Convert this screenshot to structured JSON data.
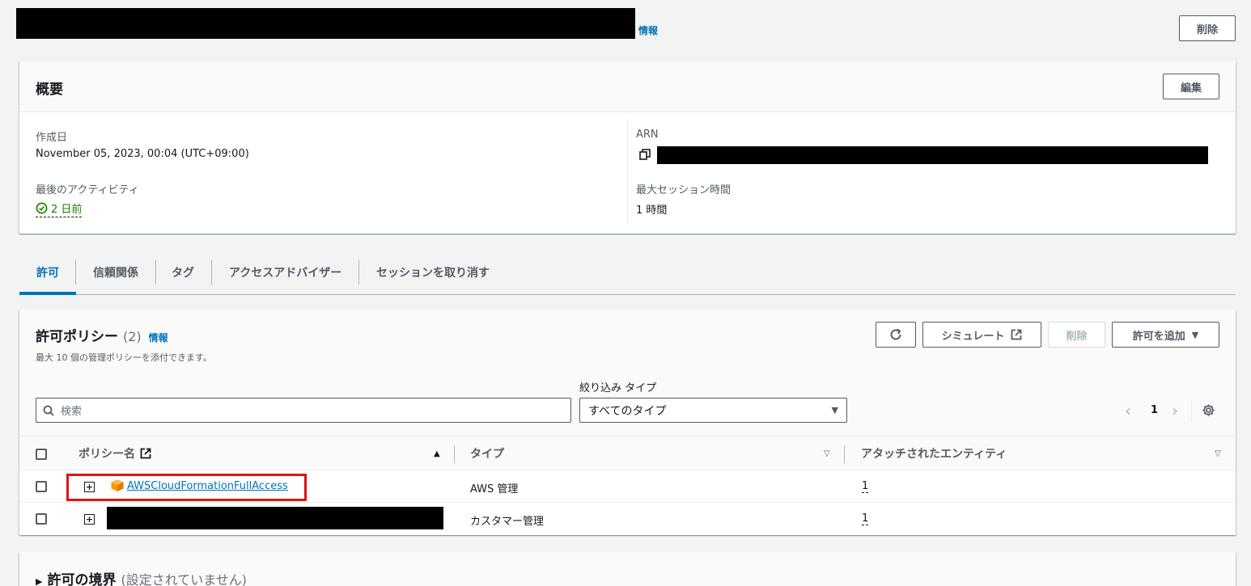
{
  "header": {
    "info_link": "情報",
    "delete_button": "削除"
  },
  "summary": {
    "title": "概要",
    "edit_button": "編集",
    "created_label": "作成日",
    "created_value": "November 05, 2023, 00:04 (UTC+09:00)",
    "last_activity_label": "最後のアクティビティ",
    "last_activity_value": "2 日前",
    "arn_label": "ARN",
    "max_session_label": "最大セッション時間",
    "max_session_value": "1 時間"
  },
  "tabs": [
    {
      "label": "許可"
    },
    {
      "label": "信頼関係"
    },
    {
      "label": "タグ"
    },
    {
      "label": "アクセスアドバイザー"
    },
    {
      "label": "セッションを取り消す"
    }
  ],
  "policies": {
    "title": "許可ポリシー",
    "count": "(2)",
    "info_link": "情報",
    "description": "最大 10 個の管理ポリシーを添付できます。",
    "simulate_button": "シミュレート",
    "delete_button": "削除",
    "add_button": "許可を追加",
    "filter_label": "絞り込み タイプ",
    "search_placeholder": "検索",
    "filter_value": "すべてのタイプ",
    "page_number": "1",
    "columns": {
      "name": "ポリシー名",
      "type": "タイプ",
      "attached": "アタッチされたエンティティ"
    },
    "rows": [
      {
        "name": "AWSCloudFormationFullAccess",
        "type": "AWS 管理",
        "attached": "1"
      },
      {
        "name": "",
        "type": "カスタマー管理",
        "attached": "1"
      }
    ]
  },
  "boundary": {
    "title": "許可の境界",
    "status": "(設定されていません)"
  },
  "colors": {
    "link": "#0073bb",
    "success": "#1d8102",
    "highlight_box": "#d91515",
    "aws_icon": "#ff9900"
  }
}
